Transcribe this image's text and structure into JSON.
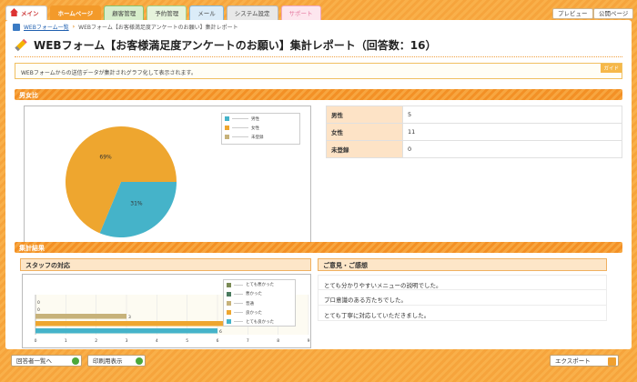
{
  "tabs": [
    {
      "label": "メイン",
      "style": "main"
    },
    {
      "label": "ホームページ",
      "style": "active"
    },
    {
      "label": "顧客管理",
      "style": "green"
    },
    {
      "label": "予約管理",
      "style": "green2"
    },
    {
      "label": "メール",
      "style": "blue"
    },
    {
      "label": "システム設定",
      "style": "gray"
    },
    {
      "label": "サポート",
      "style": "pink"
    }
  ],
  "top_buttons": {
    "preview": "プレビュー",
    "public_page": "公開ページ"
  },
  "breadcrumb": {
    "link": "WEBフォーム一覧",
    "current": "WEBフォーム【お客様満足度アンケートのお願い】集計レポート"
  },
  "page_title": "WEBフォーム【お客様満足度アンケートのお願い】集計レポート（回答数：16）",
  "info_text": "WEBフォームからの送信データが集計されグラフ化して表示されます。",
  "guide_label": "ガイド",
  "gender_section": {
    "heading": "男女比",
    "rows": [
      {
        "label": "男性",
        "value": "5"
      },
      {
        "label": "女性",
        "value": "11"
      },
      {
        "label": "未登録",
        "value": "0"
      }
    ]
  },
  "results_section": {
    "heading": "集計結果",
    "staff_heading": "スタッフの対応",
    "comments_heading": "ご意見・ご感想",
    "comments": [
      "とても分かりやすいメニューの説明でした。",
      "プロ意識のある方たちでした。",
      "とても丁寧に対応していただきました。"
    ]
  },
  "buttons": {
    "answer_list": "回答者一覧へ",
    "print_view": "印刷用表示",
    "export": "エクスポート"
  },
  "colors": {
    "male": "#45b3c9",
    "female": "#eea62f",
    "unregistered": "#c7b27a"
  },
  "chart_data": [
    {
      "type": "pie",
      "labels": [
        "男性",
        "女性",
        "未登録"
      ],
      "values": [
        5,
        11,
        0
      ],
      "data_labels": [
        "31%",
        "69%"
      ],
      "legend": "top-right"
    },
    {
      "type": "bar",
      "orientation": "horizontal",
      "categories": [
        "とても悪かった",
        "悪かった",
        "普通",
        "良かった",
        "とても良かった"
      ],
      "values": [
        0,
        0,
        3,
        7,
        6
      ],
      "data_labels": [
        "0",
        "0",
        "3",
        "",
        "6"
      ],
      "colors": [
        "#7a8a55",
        "#4a7a5e",
        "#c7b27a",
        "#eea62f",
        "#45b3c9"
      ],
      "xlim": [
        0,
        9
      ],
      "xticks": [
        "0",
        "1",
        "2",
        "3",
        "4",
        "5",
        "6",
        "7",
        "8",
        "9"
      ],
      "legend": "top-right"
    }
  ]
}
